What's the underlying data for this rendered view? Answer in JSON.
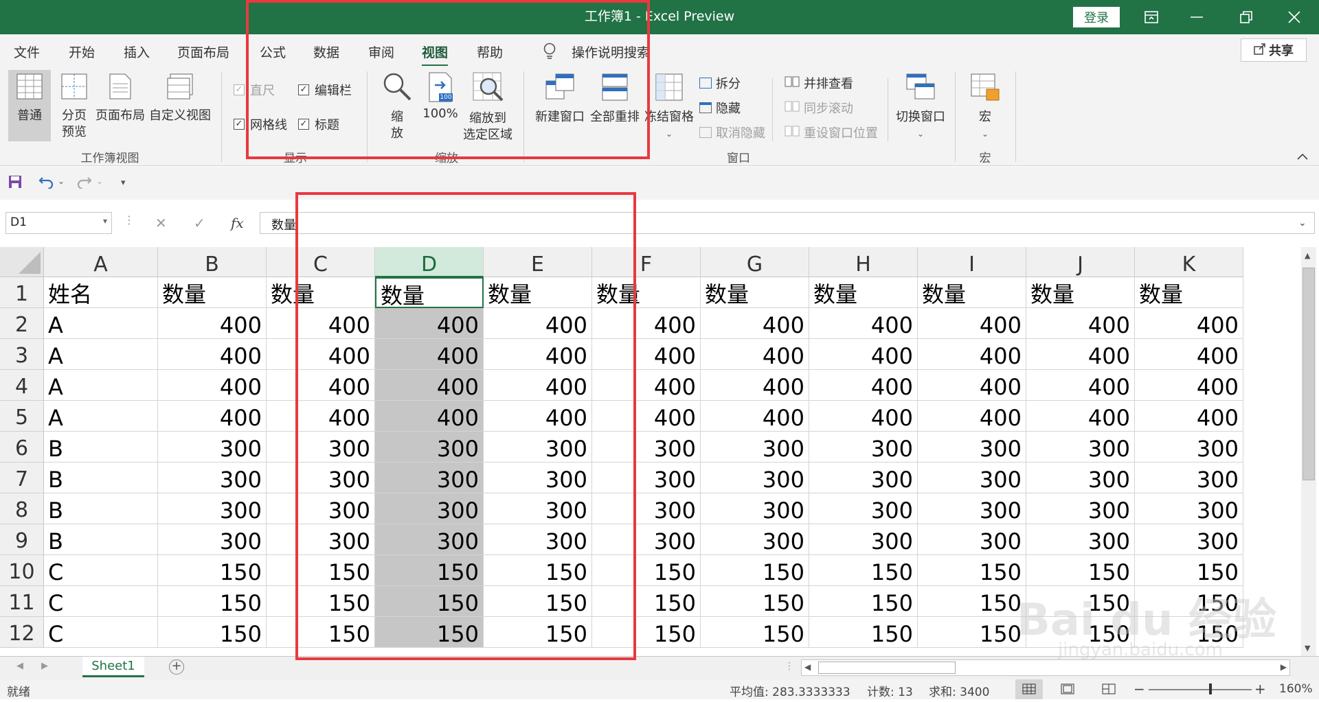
{
  "window": {
    "title": "工作簿1  -  Excel Preview",
    "login_label": "登录",
    "controls": [
      "ribbon-display-icon",
      "minimize-icon",
      "restore-icon",
      "close-icon"
    ]
  },
  "menu": {
    "tabs": [
      "文件",
      "开始",
      "插入",
      "页面布局",
      "公式",
      "数据",
      "审阅",
      "视图",
      "帮助"
    ],
    "active_tab": "视图",
    "search_label": "操作说明搜索",
    "share_label": "共享"
  },
  "ribbon": {
    "workbook_views": {
      "normal": "普通",
      "page_break_line1": "分页",
      "page_break_line2": "预览",
      "page_layout": "页面布局",
      "custom_view": "自定义视图",
      "group_label": "工作簿视图"
    },
    "show": {
      "ruler": "直尺",
      "formula_bar": "编辑栏",
      "gridlines": "网格线",
      "headings": "标题",
      "group_label": "显示"
    },
    "zoom": {
      "zoom_line1": "缩",
      "zoom_line2": "放",
      "hundred": "100%",
      "hundred_icon_text": "100",
      "to_selection_line1": "缩放到",
      "to_selection_line2": "选定区域",
      "group_label": "缩放"
    },
    "window": {
      "new_window": "新建窗口",
      "arrange_all": "全部重排",
      "freeze_panes": "冻结窗格",
      "split": "拆分",
      "hide": "隐藏",
      "unhide": "取消隐藏",
      "side_by_side": "并排查看",
      "sync_scroll": "同步滚动",
      "reset_position": "重设窗口位置",
      "switch_windows": "切换窗口",
      "group_label": "窗口"
    },
    "macros": {
      "macros": "宏",
      "group_label": "宏"
    }
  },
  "formula_bar": {
    "name_box": "D1",
    "cancel_symbol": "✕",
    "enter_symbol": "✓",
    "fx_label": "fx",
    "content": "数量"
  },
  "sheet": {
    "columns": [
      "A",
      "B",
      "C",
      "D",
      "E",
      "F",
      "G",
      "H",
      "I",
      "J",
      "K"
    ],
    "selected_column": "D",
    "active_cell": "D1",
    "rows": [
      {
        "num": "1",
        "cells": [
          "姓名",
          "数量",
          "数量",
          "数量",
          "数量",
          "数量",
          "数量",
          "数量",
          "数量",
          "数量",
          "数量"
        ]
      },
      {
        "num": "2",
        "cells": [
          "A",
          "400",
          "400",
          "400",
          "400",
          "400",
          "400",
          "400",
          "400",
          "400",
          "400"
        ]
      },
      {
        "num": "3",
        "cells": [
          "A",
          "400",
          "400",
          "400",
          "400",
          "400",
          "400",
          "400",
          "400",
          "400",
          "400"
        ]
      },
      {
        "num": "4",
        "cells": [
          "A",
          "400",
          "400",
          "400",
          "400",
          "400",
          "400",
          "400",
          "400",
          "400",
          "400"
        ]
      },
      {
        "num": "5",
        "cells": [
          "A",
          "400",
          "400",
          "400",
          "400",
          "400",
          "400",
          "400",
          "400",
          "400",
          "400"
        ]
      },
      {
        "num": "6",
        "cells": [
          "B",
          "300",
          "300",
          "300",
          "300",
          "300",
          "300",
          "300",
          "300",
          "300",
          "300"
        ]
      },
      {
        "num": "7",
        "cells": [
          "B",
          "300",
          "300",
          "300",
          "300",
          "300",
          "300",
          "300",
          "300",
          "300",
          "300"
        ]
      },
      {
        "num": "8",
        "cells": [
          "B",
          "300",
          "300",
          "300",
          "300",
          "300",
          "300",
          "300",
          "300",
          "300",
          "300"
        ]
      },
      {
        "num": "9",
        "cells": [
          "B",
          "300",
          "300",
          "300",
          "300",
          "300",
          "300",
          "300",
          "300",
          "300",
          "300"
        ]
      },
      {
        "num": "10",
        "cells": [
          "C",
          "150",
          "150",
          "150",
          "150",
          "150",
          "150",
          "150",
          "150",
          "150",
          "150"
        ]
      },
      {
        "num": "11",
        "cells": [
          "C",
          "150",
          "150",
          "150",
          "150",
          "150",
          "150",
          "150",
          "150",
          "150",
          "150"
        ]
      },
      {
        "num": "12",
        "cells": [
          "C",
          "150",
          "150",
          "150",
          "150",
          "150",
          "150",
          "150",
          "150",
          "150",
          "150"
        ]
      }
    ]
  },
  "sheet_tabs": {
    "tabs": [
      "Sheet1"
    ],
    "add_symbol": "+"
  },
  "status_bar": {
    "ready": "就绪",
    "average": "平均值: 283.3333333",
    "count": "计数: 13",
    "sum": "求和: 3400",
    "zoom": "160%"
  },
  "watermark": {
    "main": "Bai du 经验",
    "sub": "jingyan.baidu.com"
  },
  "colors": {
    "accent": "#217346",
    "highlight_box": "#e8393f",
    "selected_fill": "#c6c6c6"
  }
}
